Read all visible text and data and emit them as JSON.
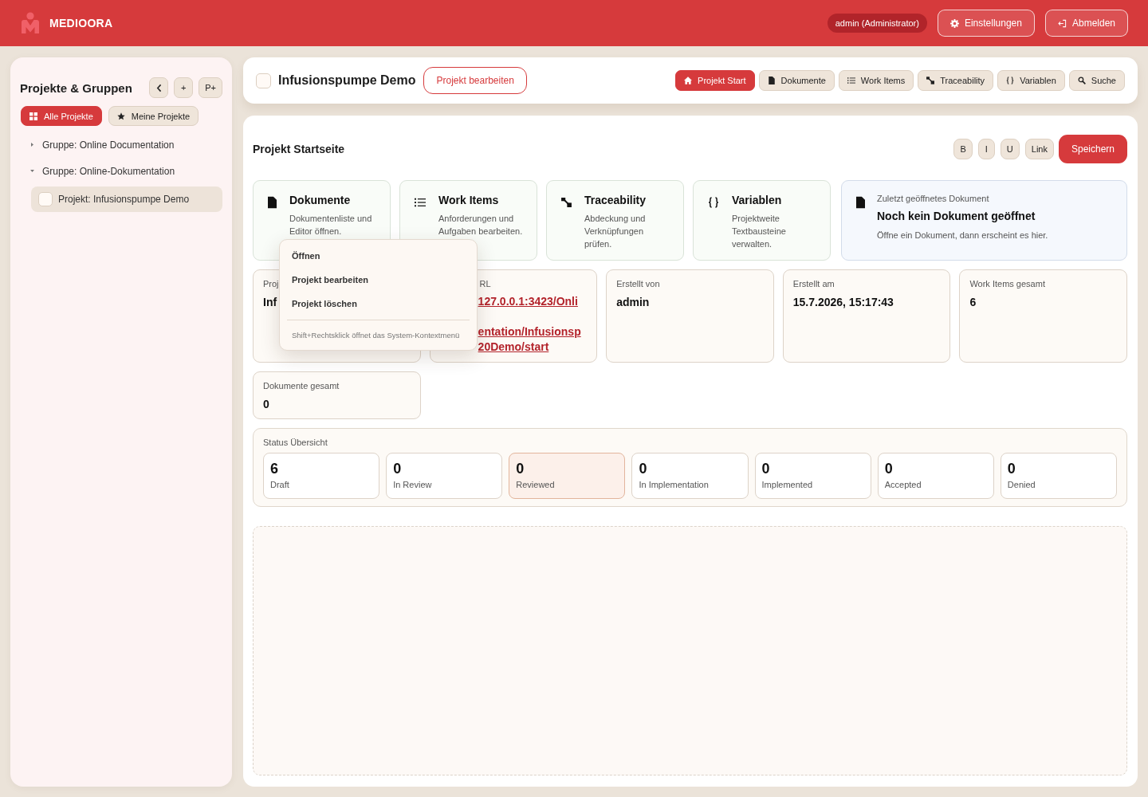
{
  "header": {
    "brand": "MEDIOORA",
    "user_badge": "admin (Administrator)",
    "buttons": [
      "Einstellungen",
      "Abmelden"
    ]
  },
  "sidebar": {
    "title": "Projekte & Gruppen",
    "tool_buttons": [
      {
        "kind": "icon"
      },
      {
        "kind": "text",
        "label": "+"
      },
      {
        "kind": "text",
        "label": "P+"
      }
    ],
    "filters": [
      {
        "label": "Alle Projekte",
        "selected": true
      },
      {
        "label": "Meine Projekte",
        "selected": false
      }
    ],
    "tree": [
      {
        "label": "Gruppe: Online Documentation",
        "expanded": false
      },
      {
        "label": "Gruppe: Online-Dokumentation",
        "expanded": true,
        "children": [
          {
            "label": "Projekt: Infusionspumpe Demo",
            "selected": true
          }
        ]
      }
    ]
  },
  "project_bar": {
    "title": "Infusionspumpe Demo",
    "edit_button": "Projekt bearbeiten",
    "tabs": [
      {
        "label": "Projekt Start",
        "selected": true
      },
      {
        "label": "Dokumente",
        "selected": false
      },
      {
        "label": "Work Items",
        "selected": false
      },
      {
        "label": "Traceability",
        "selected": false
      },
      {
        "label": "Variablen",
        "selected": false
      },
      {
        "label": "Suche",
        "selected": false
      }
    ]
  },
  "editor": {
    "title": "Projekt Startseite",
    "format_buttons": [
      "B",
      "I",
      "U",
      "Link"
    ],
    "save_button": "Speichern"
  },
  "feature_cards": [
    {
      "title": "Dokumente",
      "description": "Dokumentenliste und Editor öffnen."
    },
    {
      "title": "Work Items",
      "description": "Anforderungen und Aufgaben bearbeiten."
    },
    {
      "title": "Traceability",
      "description": "Abdeckung und Verknüpfungen prüfen."
    },
    {
      "title": "Variablen",
      "description": "Projektweite Textbausteine verwalten."
    }
  ],
  "recent_document": {
    "label": "Zuletzt geöffnetes Dokument",
    "title": "Noch kein Dokument geöffnet",
    "hint": "Öffne ein Dokument, dann erscheint es hier."
  },
  "info_cards": [
    {
      "kind": "text",
      "label": "Proj",
      "value": "Inf"
    },
    {
      "kind": "link",
      "label": "RL",
      "link_lines": [
        "127.0.0.1:3423/Onli",
        "entation/Infusionsp",
        "20Demo/start"
      ]
    },
    {
      "kind": "text",
      "label": "Erstellt von",
      "value": "admin"
    },
    {
      "kind": "text",
      "label": "Erstellt am",
      "value": "15.7.2026, 15:17:43"
    },
    {
      "kind": "text",
      "label": "Work Items gesamt",
      "value": "6"
    },
    {
      "kind": "text",
      "label": "Dokumente gesamt",
      "value": "0"
    }
  ],
  "context_menu": {
    "items": [
      "Öffnen",
      "Projekt bearbeiten",
      "Projekt löschen"
    ],
    "hint": "Shift+Rechtsklick öffnet das System-Kontextmenü"
  },
  "status_overview": {
    "title": "Status Übersicht",
    "tiles": [
      {
        "count": "6",
        "label": "Draft",
        "selected": false
      },
      {
        "count": "0",
        "label": "In Review",
        "selected": false
      },
      {
        "count": "0",
        "label": "Reviewed",
        "selected": true
      },
      {
        "count": "0",
        "label": "In Implementation",
        "selected": false
      },
      {
        "count": "0",
        "label": "Implemented",
        "selected": false
      },
      {
        "count": "0",
        "label": "Accepted",
        "selected": false
      },
      {
        "count": "0",
        "label": "Denied",
        "selected": false
      }
    ]
  }
}
